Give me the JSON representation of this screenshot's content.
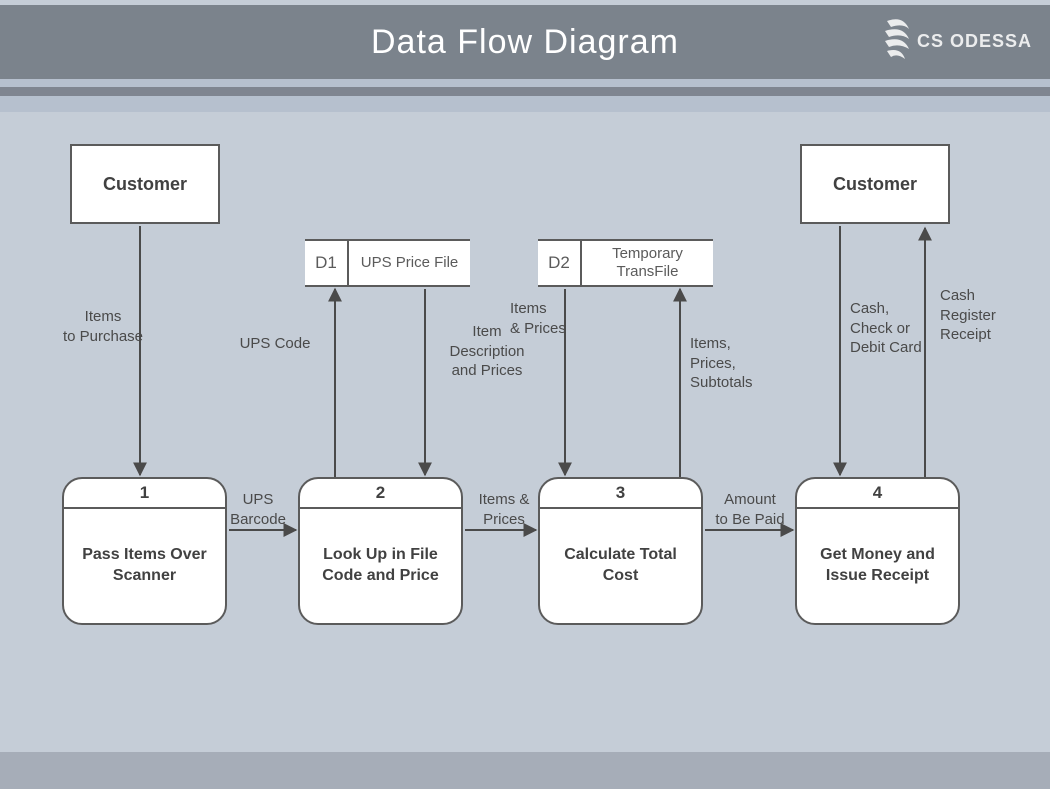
{
  "title": "Data Flow Diagram",
  "brand": "CS ODESSA",
  "entities": {
    "customer_left": "Customer",
    "customer_right": "Customer"
  },
  "stores": {
    "d1": {
      "id": "D1",
      "name": "UPS Price File"
    },
    "d2": {
      "id": "D2",
      "name": "Temporary TransFile"
    }
  },
  "processes": {
    "p1": {
      "num": "1",
      "name": "Pass Items Over Scanner"
    },
    "p2": {
      "num": "2",
      "name": "Look Up in File Code and Price"
    },
    "p3": {
      "num": "3",
      "name": "Calculate Total Cost"
    },
    "p4": {
      "num": "4",
      "name": "Get Money and Issue Receipt"
    }
  },
  "flows": {
    "items_to_purchase": "Items\nto Purchase",
    "ups_code": "UPS Code",
    "item_desc": "Item\nDescription\nand Prices",
    "items_prices_in": "Items\n& Prices",
    "items_prices_sub": "Items,\nPrices,\nSubtotals",
    "cash_check": "Cash,\nCheck or\nDebit Card",
    "cash_register": "Cash\nRegister\nReceipt",
    "ups_barcode": "UPS\nBarcode",
    "items_prices_h": "Items &\nPrices",
    "amount_paid": "Amount\nto Be Paid"
  }
}
